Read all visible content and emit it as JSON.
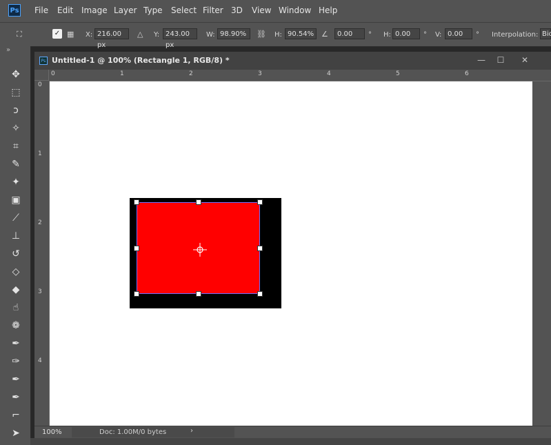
{
  "app": {
    "logo": "Ps"
  },
  "menu": [
    "File",
    "Edit",
    "Image",
    "Layer",
    "Type",
    "Select",
    "Filter",
    "3D",
    "View",
    "Window",
    "Help"
  ],
  "options": {
    "x_label": "X:",
    "x_value": "216.00 px",
    "y_label": "Y:",
    "y_value": "243.00 px",
    "w_label": "W:",
    "w_value": "98.90%",
    "h_label": "H:",
    "h_value": "90.54%",
    "angle_value": "0.00",
    "angle_unit": "°",
    "hskew_label": "H:",
    "hskew_value": "0.00",
    "hskew_unit": "°",
    "vskew_label": "V:",
    "vskew_value": "0.00",
    "vskew_unit": "°",
    "interp_label": "Interpolation:",
    "interp_value": "Bic"
  },
  "document": {
    "title": "Untitled-1 @ 100% (Rectangle 1, RGB/8) *",
    "ruler_top": [
      "0",
      "1",
      "2",
      "3",
      "4",
      "5",
      "6"
    ],
    "ruler_left": [
      "0",
      "1",
      "2",
      "3",
      "4"
    ]
  },
  "colors": {
    "shape_fill": "#ff0000",
    "shape_background": "#000000",
    "canvas": "#ffffff"
  },
  "status": {
    "zoom": "100%",
    "doc_info": "Doc: 1.00M/0 bytes"
  },
  "tools": [
    "move-icon",
    "marquee-icon",
    "lasso-icon",
    "magic-wand-icon",
    "crop-icon",
    "eyedropper-icon",
    "spot-healing-icon",
    "healing-brush-icon",
    "brush-icon",
    "clone-stamp-icon",
    "history-brush-icon",
    "eraser-icon",
    "paint-bucket-icon",
    "smudge-icon",
    "sponge-icon",
    "pen-icon",
    "freeform-pen-icon",
    "add-anchor-icon",
    "delete-anchor-icon",
    "convert-point-icon",
    "path-selection-icon"
  ]
}
